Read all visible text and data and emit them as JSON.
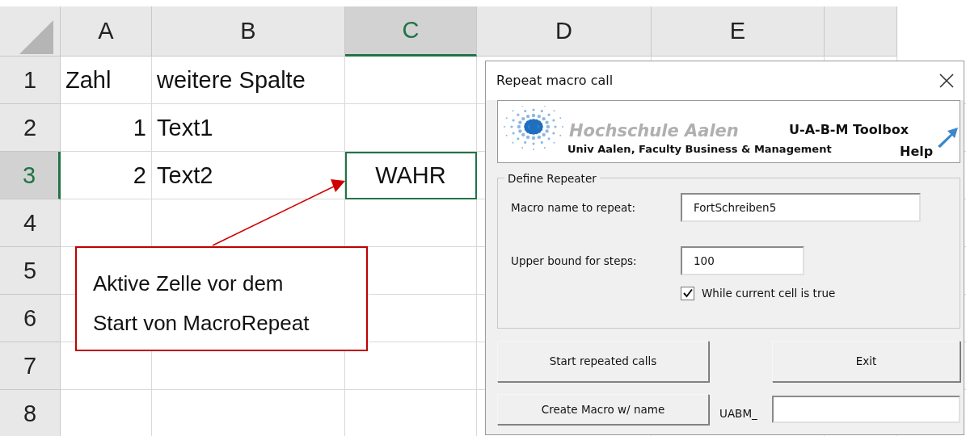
{
  "sheet": {
    "columns": [
      {
        "label": "A",
        "selected": false
      },
      {
        "label": "B",
        "selected": false
      },
      {
        "label": "C",
        "selected": true
      },
      {
        "label": "D",
        "selected": false
      },
      {
        "label": "E",
        "selected": false
      }
    ],
    "rows": [
      {
        "label": "1",
        "selected": false,
        "a": {
          "kind": "text",
          "text": "Zahl",
          "active": false
        },
        "b": {
          "kind": "text",
          "text": "weitere Spalte",
          "active": false
        }
      },
      {
        "label": "2",
        "selected": false,
        "a": {
          "kind": "number",
          "text": "1",
          "active": false
        },
        "b": {
          "kind": "text",
          "text": "Text1",
          "active": false
        }
      },
      {
        "label": "3",
        "selected": true,
        "a": {
          "kind": "number",
          "text": "2",
          "active": false
        },
        "b": {
          "kind": "text",
          "text": "Text2",
          "active": false
        },
        "c": {
          "kind": "boolean",
          "text": "WAHR",
          "active": true
        }
      },
      {
        "label": "4",
        "selected": false
      },
      {
        "label": "5",
        "selected": false
      },
      {
        "label": "6",
        "selected": false
      },
      {
        "label": "7",
        "selected": false
      },
      {
        "label": "8",
        "selected": false
      }
    ]
  },
  "callout": {
    "text": "Aktive Zelle vor dem Start von MacroRepeat"
  },
  "dialog": {
    "title": "Repeat macro call",
    "banner": {
      "school": "Hochschule Aalen",
      "toolbox": "U-A-B-M Toolbox",
      "faculty": "Univ Aalen, Faculty Business & Management",
      "help": "Help"
    },
    "group": {
      "legend": "Define Repeater",
      "macro_name": {
        "label": "Macro name to repeat:",
        "value": "FortSchreiben5"
      },
      "upper_bound": {
        "label": "Upper bound for steps:",
        "value": "100"
      },
      "while_true": {
        "label": "While current cell is true",
        "checked": true
      }
    },
    "buttons": {
      "start": "Start repeated calls",
      "exit": "Exit",
      "create": "Create Macro w/ name"
    },
    "prefix": {
      "label": "UABM_"
    }
  }
}
